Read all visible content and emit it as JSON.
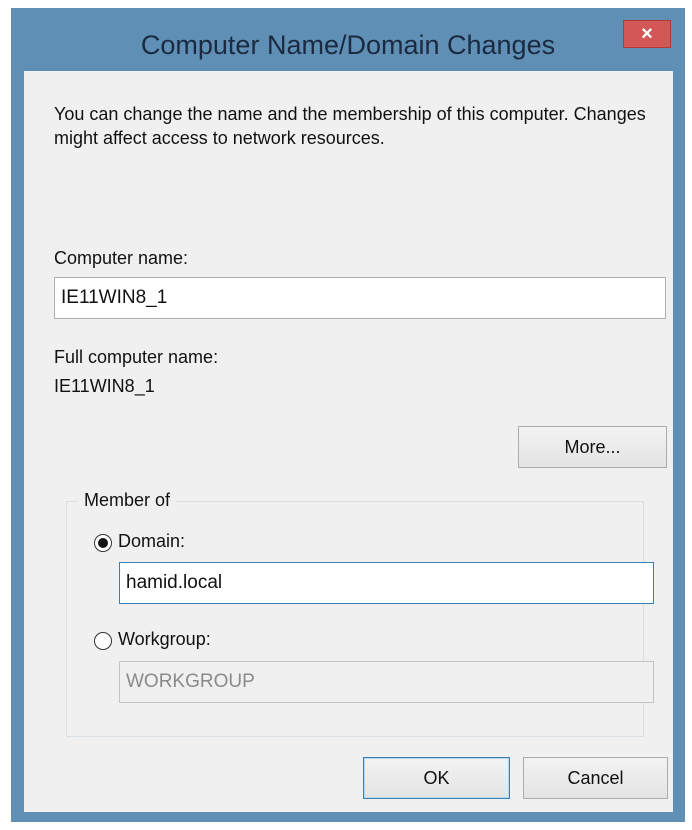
{
  "window": {
    "title": "Computer Name/Domain Changes",
    "close_glyph": "×"
  },
  "description": "You can change the name and the membership of this computer. Changes might affect access to network resources.",
  "computer_name": {
    "label": "Computer name:",
    "value": "IE11WIN8_1"
  },
  "full_computer_name": {
    "label": "Full computer name:",
    "value": "IE11WIN8_1"
  },
  "more_button": "More...",
  "member_of": {
    "legend": "Member of",
    "domain": {
      "label": "Domain:",
      "selected": true,
      "value": "hamid.local"
    },
    "workgroup": {
      "label": "Workgroup:",
      "selected": false,
      "value": "WORKGROUP"
    }
  },
  "buttons": {
    "ok": "OK",
    "cancel": "Cancel"
  },
  "colors": {
    "frame": "#5f8fb5",
    "close": "#d35757",
    "client": "#f0f0f0",
    "focus_border": "#3c7fb1"
  }
}
